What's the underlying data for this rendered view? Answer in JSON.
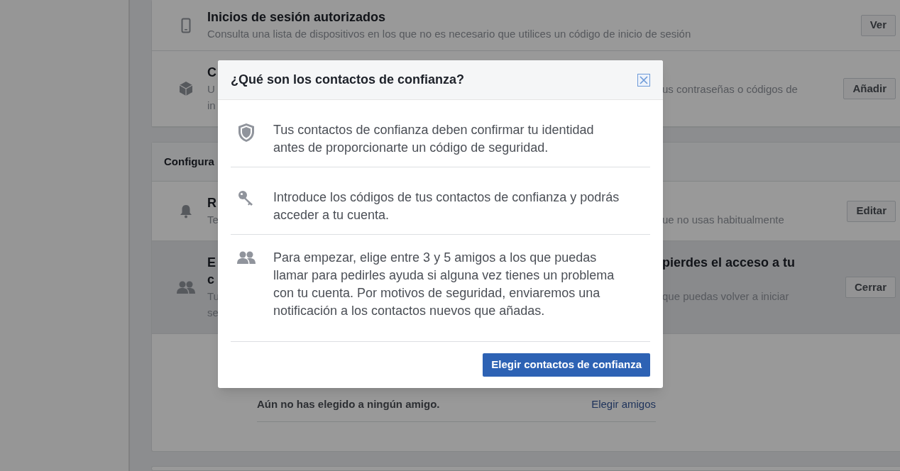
{
  "background": {
    "sections": [
      {
        "rows": [
          {
            "kind": "phone",
            "highlighted": false,
            "button": "Ver",
            "lines": [
              {
                "kind": "title",
                "left": "Inicios de sesión autorizados"
              },
              {
                "kind": "desc",
                "left": "Consulta una lista de dispositivos en los que no es necesario que utilices un código de inicio de sesión"
              }
            ]
          },
          {
            "kind": "cube",
            "highlighted": false,
            "button": "Añadir",
            "lines": [
              {
                "kind": "title",
                "left": "C"
              },
              {
                "kind": "desc",
                "left": "U",
                "right": "us contraseñas o códigos de"
              },
              {
                "kind": "desc",
                "left": "in"
              }
            ]
          }
        ]
      },
      {
        "header": "Configura",
        "rows": [
          {
            "kind": "bell",
            "highlighted": false,
            "button": "Editar",
            "lines": [
              {
                "kind": "title",
                "left": "R"
              },
              {
                "kind": "desc",
                "left": "Te",
                "right": "ue no usas habitualmente"
              }
            ]
          },
          {
            "kind": "people",
            "highlighted": true,
            "button": "Cerrar",
            "lines": [
              {
                "kind": "title",
                "left": "E",
                "right": "pierdes el acceso a tu"
              },
              {
                "kind": "title",
                "left": "c"
              },
              {
                "kind": "desc",
                "left": "Tu",
                "right": "que puedas volver a iniciar"
              },
              {
                "kind": "desc",
                "left": "se"
              }
            ]
          }
        ],
        "friends": {
          "text": "Aún no has elegido a ningún amigo.",
          "link": "Elegir amigos"
        }
      }
    ]
  },
  "dialog": {
    "title": "¿Qué son los contactos de confianza?",
    "items": [
      {
        "kind": "shield",
        "text": "Tus contactos de confianza deben confirmar tu identidad antes de proporcionarte un código de seguridad."
      },
      {
        "kind": "key",
        "text": "Introduce los códigos de tus contactos de confianza y podrás acceder a tu cuenta."
      },
      {
        "kind": "people",
        "text": "Para empezar, elige entre 3 y 5 amigos a los que puedas llamar para pedirles ayuda si alguna vez tienes un problema con tu cuenta. Por motivos de seguridad, enviaremos una notificación a los contactos nuevos que añadas."
      }
    ],
    "button": "Elegir contactos de confianza"
  }
}
